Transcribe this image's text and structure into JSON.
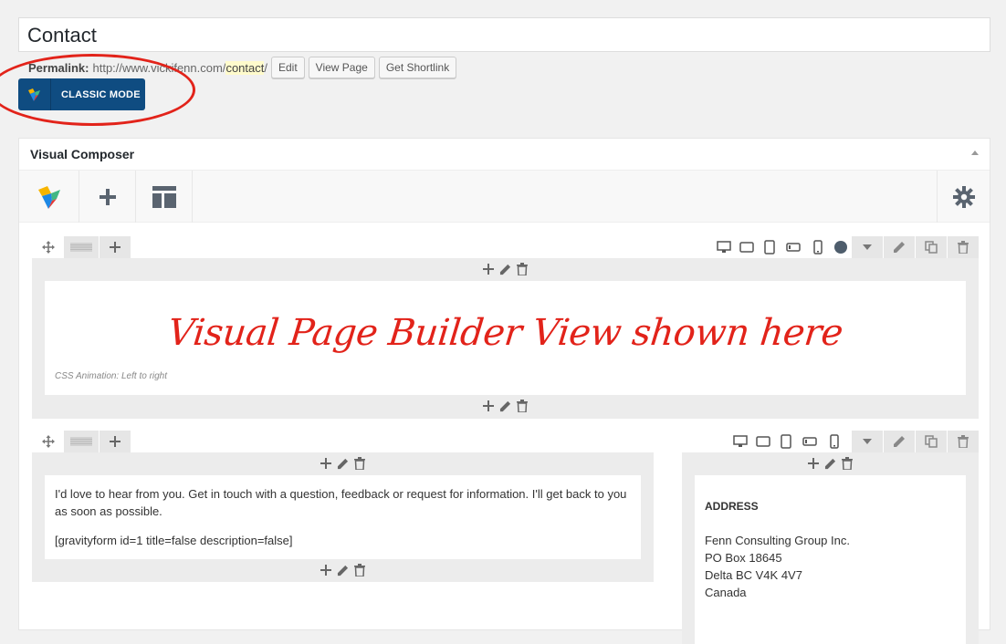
{
  "post_title": "Contact",
  "permalink": {
    "label": "Permalink:",
    "base_url": "http://www.vickifenn.com/",
    "slug": "contact",
    "trailing": "/",
    "edit_label": "Edit",
    "view_label": "View Page",
    "shortlink_label": "Get Shortlink"
  },
  "classic_mode_label": "CLASSIC MODE",
  "annotation_color": "#e2231a",
  "visual_composer": {
    "title": "Visual Composer",
    "toolbar": {
      "logo_icon": "vc-logo-icon",
      "add_icon": "plus-icon",
      "templates_icon": "layout-icon",
      "settings_icon": "gear-icon"
    }
  },
  "row1": {
    "handwritten_text": "Visual Page Builder View shown here",
    "animation_label": "CSS Animation: Left to right"
  },
  "row2": {
    "intro": "I'd love to hear from you. Get in touch with a question, feedback or request for information. I'll get back to you as soon as possible.",
    "shortcode": "[gravityform id=1 title=false description=false]",
    "address_heading": "ADDRESS",
    "address_lines": [
      "Fenn Consulting Group Inc.",
      "PO Box 18645",
      "Delta BC V4K 4V7",
      "Canada"
    ]
  },
  "colors": {
    "classic_button": "#0f4c81",
    "annotation_red": "#e2231a",
    "circle_indicator": "#4e5d6c"
  }
}
